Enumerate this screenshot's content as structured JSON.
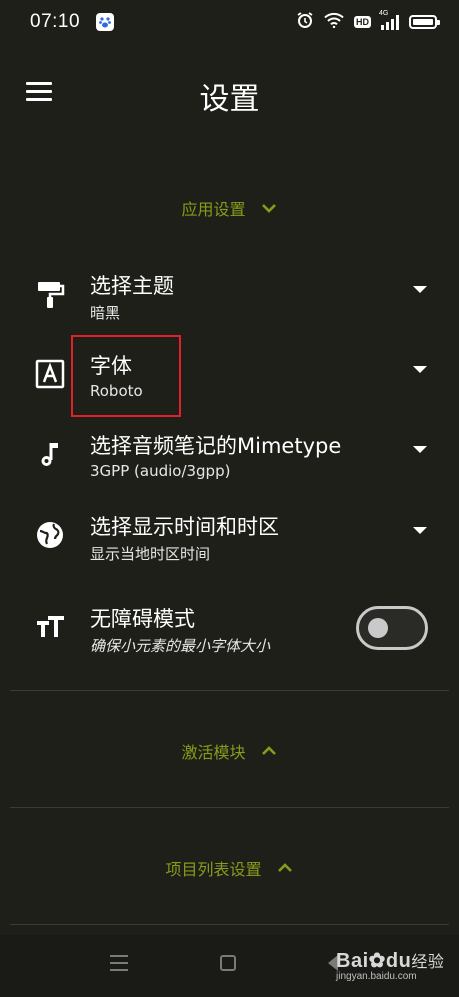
{
  "status": {
    "time": "07:10",
    "hd": "HD",
    "net": "4G"
  },
  "appbar": {
    "title": "设置"
  },
  "sections": {
    "app_settings": "应用设置",
    "activation": "激活模块",
    "project_list": "项目列表设置"
  },
  "settings": {
    "theme": {
      "label": "选择主题",
      "value": "暗黑"
    },
    "font": {
      "label": "字体",
      "value": "Roboto"
    },
    "mimetype": {
      "label": "选择音频笔记的Mimetype",
      "value": "3GPP (audio/3gpp)"
    },
    "timezone": {
      "label": "选择显示时间和时区",
      "value": "显示当地时区时间"
    },
    "accessibility": {
      "label": "无障碍模式",
      "value": "确保小元素的最小字体大小",
      "enabled": false
    }
  },
  "watermark": {
    "brand": "Bai",
    "brand2": "du",
    "cn": "经验",
    "url": "jingyan.baidu.com"
  },
  "colors": {
    "background": "#1e1f19",
    "accent": "#8a9a1a",
    "highlight": "#e0202a"
  }
}
